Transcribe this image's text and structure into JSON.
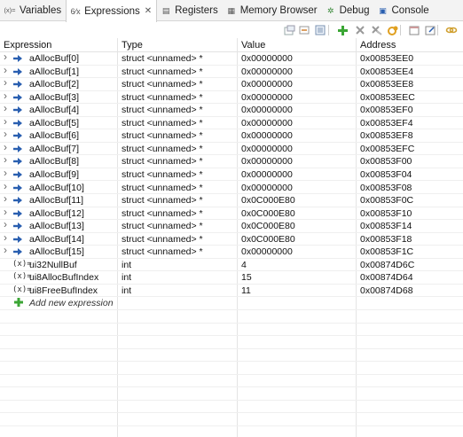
{
  "tabs": [
    {
      "label": "Variables",
      "icon": "variables-icon",
      "active": false
    },
    {
      "label": "Expressions",
      "icon": "expressions-icon",
      "active": true
    },
    {
      "label": "Registers",
      "icon": "registers-icon",
      "active": false
    },
    {
      "label": "Memory Browser",
      "icon": "memory-browser-icon",
      "active": false
    },
    {
      "label": "Debug",
      "icon": "debug-icon",
      "active": false
    },
    {
      "label": "Console",
      "icon": "console-icon",
      "active": false
    }
  ],
  "active_tab_close": "✕",
  "toolbar": [
    "show-type-names-icon",
    "collapse-all-icon",
    "select-all-icon",
    "add-expression-icon",
    "remove-icon",
    "remove-all-icon",
    "refresh-icon",
    "new-watch-icon",
    "export-icon",
    "link-icon"
  ],
  "columns": [
    "Expression",
    "Type",
    "Value",
    "Address"
  ],
  "rows": [
    {
      "expr": "aAllocBuf[0]",
      "type": "struct <unnamed> *",
      "value": "0x00000000",
      "address": "0x00853EE0",
      "kind": "pointer"
    },
    {
      "expr": "aAllocBuf[1]",
      "type": "struct <unnamed> *",
      "value": "0x00000000",
      "address": "0x00853EE4",
      "kind": "pointer"
    },
    {
      "expr": "aAllocBuf[2]",
      "type": "struct <unnamed> *",
      "value": "0x00000000",
      "address": "0x00853EE8",
      "kind": "pointer"
    },
    {
      "expr": "aAllocBuf[3]",
      "type": "struct <unnamed> *",
      "value": "0x00000000",
      "address": "0x00853EEC",
      "kind": "pointer"
    },
    {
      "expr": "aAllocBuf[4]",
      "type": "struct <unnamed> *",
      "value": "0x00000000",
      "address": "0x00853EF0",
      "kind": "pointer"
    },
    {
      "expr": "aAllocBuf[5]",
      "type": "struct <unnamed> *",
      "value": "0x00000000",
      "address": "0x00853EF4",
      "kind": "pointer"
    },
    {
      "expr": "aAllocBuf[6]",
      "type": "struct <unnamed> *",
      "value": "0x00000000",
      "address": "0x00853EF8",
      "kind": "pointer"
    },
    {
      "expr": "aAllocBuf[7]",
      "type": "struct <unnamed> *",
      "value": "0x00000000",
      "address": "0x00853EFC",
      "kind": "pointer"
    },
    {
      "expr": "aAllocBuf[8]",
      "type": "struct <unnamed> *",
      "value": "0x00000000",
      "address": "0x00853F00",
      "kind": "pointer"
    },
    {
      "expr": "aAllocBuf[9]",
      "type": "struct <unnamed> *",
      "value": "0x00000000",
      "address": "0x00853F04",
      "kind": "pointer"
    },
    {
      "expr": "aAllocBuf[10]",
      "type": "struct <unnamed> *",
      "value": "0x00000000",
      "address": "0x00853F08",
      "kind": "pointer"
    },
    {
      "expr": "aAllocBuf[11]",
      "type": "struct <unnamed> *",
      "value": "0x0C000E80",
      "address": "0x00853F0C",
      "kind": "pointer"
    },
    {
      "expr": "aAllocBuf[12]",
      "type": "struct <unnamed> *",
      "value": "0x0C000E80",
      "address": "0x00853F10",
      "kind": "pointer"
    },
    {
      "expr": "aAllocBuf[13]",
      "type": "struct <unnamed> *",
      "value": "0x0C000E80",
      "address": "0x00853F14",
      "kind": "pointer"
    },
    {
      "expr": "aAllocBuf[14]",
      "type": "struct <unnamed> *",
      "value": "0x0C000E80",
      "address": "0x00853F18",
      "kind": "pointer"
    },
    {
      "expr": "aAllocBuf[15]",
      "type": "struct <unnamed> *",
      "value": "0x00000000",
      "address": "0x00853F1C",
      "kind": "pointer"
    },
    {
      "expr": "ui32NullBuf",
      "type": "int",
      "value": "4",
      "address": "0x00874D6C",
      "kind": "scalar"
    },
    {
      "expr": "ui8AllocBufIndex",
      "type": "int",
      "value": "15",
      "address": "0x00874D64",
      "kind": "scalar"
    },
    {
      "expr": "ui8FreeBufIndex",
      "type": "int",
      "value": "11",
      "address": "0x00874D68",
      "kind": "scalar"
    }
  ],
  "add_expression_label": "Add new expression",
  "icons": {
    "expand": "chevron-right-icon",
    "pointer": "pointer-arrow-icon",
    "scalar": "variable-icon",
    "scalar_glyph": "(x)=",
    "add": "add-expression-icon"
  },
  "colors": {
    "pointer_arrow": "#2a5fb0",
    "add_plus": "#3ba635"
  }
}
